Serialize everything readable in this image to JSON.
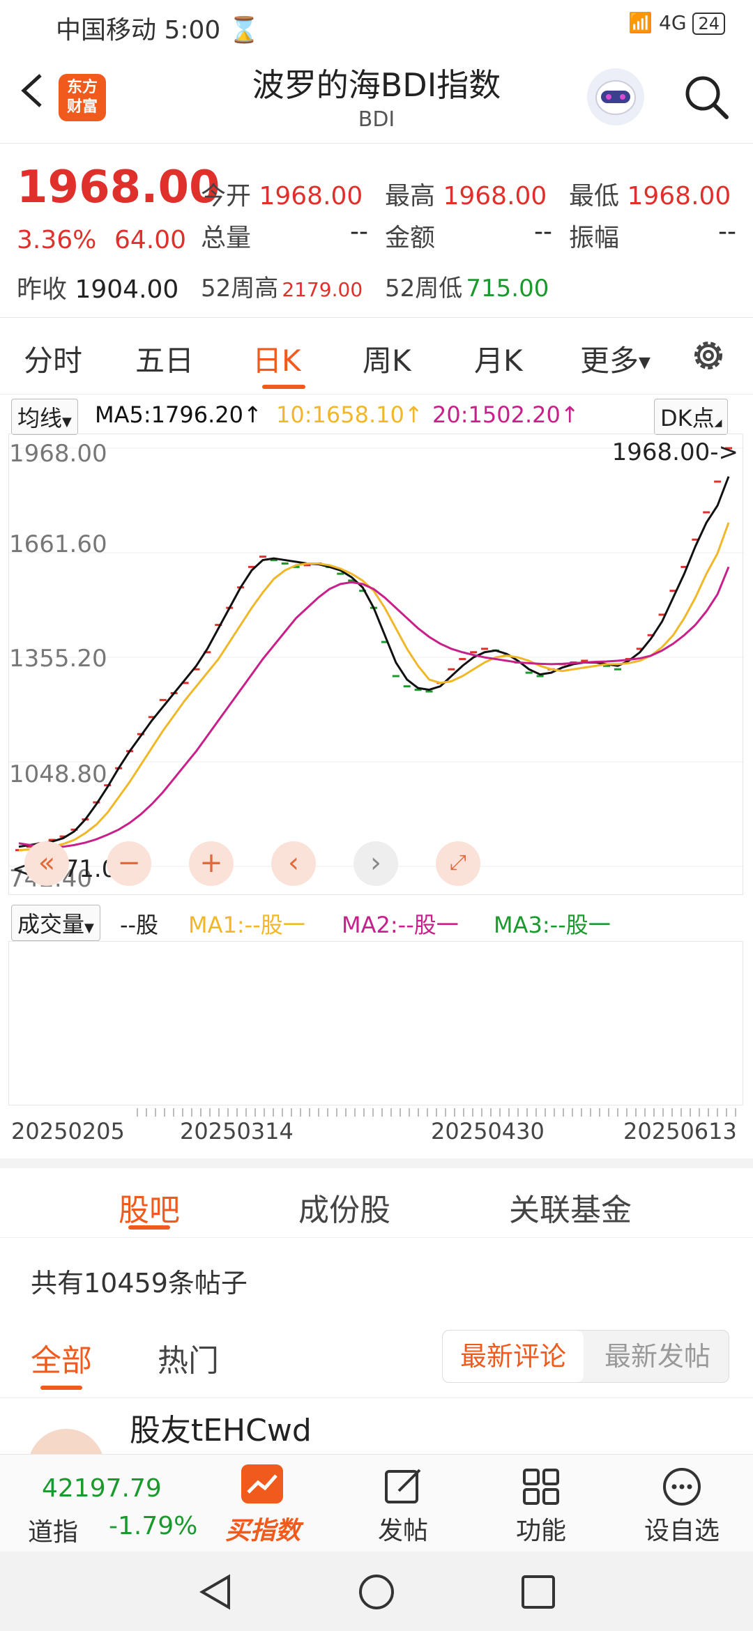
{
  "status": {
    "carrier": "中国移动",
    "time": "5:00",
    "network": "4G",
    "battery": "24"
  },
  "header": {
    "logo_line1": "东方",
    "logo_line2": "财富",
    "title": "波罗的海BDI指数",
    "code": "BDI"
  },
  "quote": {
    "price": "1968.00",
    "change_pct": "3.36%",
    "change_amt": "64.00",
    "prev_close_label": "昨收",
    "prev_close": "1904.00",
    "open_label": "今开",
    "open": "1968.00",
    "high_label": "最高",
    "high": "1968.00",
    "low_label": "最低",
    "low": "1968.00",
    "volume_label": "总量",
    "volume": "--",
    "amount_label": "金额",
    "amount": "--",
    "amplitude_label": "振幅",
    "amplitude": "--",
    "week52_high_label": "52周高",
    "week52_high": "2179.00",
    "week52_low_label": "52周低",
    "week52_low": "715.00"
  },
  "ktabs": [
    "分时",
    "五日",
    "日K",
    "周K",
    "月K",
    "更多"
  ],
  "ma": {
    "selector": "均线",
    "ma5": "MA5:1796.20↑",
    "ma10": "10:1658.10↑",
    "ma20": "20:1502.20↑",
    "dk": "DK点"
  },
  "colors": {
    "accent": "#f05a1d",
    "red": "#e0302c",
    "green": "#1a9a2c",
    "ma5": "#111111",
    "ma10": "#f0b829",
    "ma20": "#c8208a"
  },
  "chart_data": {
    "type": "line",
    "y_ticks": [
      "1968.00",
      "1661.60",
      "1355.20",
      "1048.80",
      "742.40"
    ],
    "last_price_label": "1968.00->",
    "low_label": "<--771.00",
    "ylim": [
      742.4,
      1968.0
    ],
    "x_ticks": [
      "20250205",
      "20250314",
      "20250430",
      "20250613"
    ],
    "candles": [
      790,
      800,
      810,
      820,
      830,
      850,
      880,
      930,
      980,
      1030,
      1080,
      1130,
      1180,
      1230,
      1250,
      1280,
      1320,
      1370,
      1450,
      1500,
      1560,
      1620,
      1650,
      1640,
      1630,
      1620,
      1625,
      1630,
      1620,
      1600,
      1580,
      1550,
      1500,
      1400,
      1300,
      1270,
      1260,
      1255,
      1280,
      1320,
      1350,
      1370,
      1380,
      1375,
      1360,
      1340,
      1310,
      1300,
      1320,
      1335,
      1340,
      1345,
      1340,
      1330,
      1320,
      1350,
      1380,
      1420,
      1480,
      1550,
      1620,
      1700,
      1780,
      1870,
      1968
    ],
    "series": [
      {
        "name": "MA5",
        "values": [
          800,
          805,
          810,
          815,
          825,
          845,
          880,
          925,
          975,
          1030,
          1080,
          1125,
          1170,
          1210,
          1250,
          1290,
          1330,
          1380,
          1440,
          1500,
          1560,
          1610,
          1640,
          1645,
          1640,
          1635,
          1630,
          1628,
          1620,
          1610,
          1590,
          1560,
          1500,
          1420,
          1340,
          1290,
          1265,
          1260,
          1270,
          1300,
          1330,
          1355,
          1370,
          1375,
          1365,
          1345,
          1320,
          1305,
          1310,
          1325,
          1335,
          1340,
          1340,
          1335,
          1330,
          1345,
          1370,
          1410,
          1460,
          1530,
          1600,
          1680,
          1750,
          1800,
          1885
        ]
      },
      {
        "name": "MA10",
        "values": [
          790,
          792,
          795,
          800,
          808,
          820,
          840,
          865,
          900,
          945,
          990,
          1040,
          1090,
          1140,
          1185,
          1230,
          1270,
          1310,
          1350,
          1400,
          1450,
          1500,
          1545,
          1585,
          1610,
          1625,
          1630,
          1630,
          1625,
          1615,
          1600,
          1580,
          1550,
          1500,
          1440,
          1380,
          1330,
          1290,
          1280,
          1285,
          1300,
          1320,
          1340,
          1355,
          1360,
          1355,
          1345,
          1330,
          1320,
          1315,
          1320,
          1325,
          1330,
          1335,
          1335,
          1338,
          1345,
          1360,
          1385,
          1420,
          1470,
          1530,
          1600,
          1660,
          1750
        ]
      },
      {
        "name": "MA20",
        "values": [
          810,
          805,
          800,
          798,
          800,
          805,
          812,
          822,
          835,
          850,
          870,
          895,
          925,
          960,
          1000,
          1040,
          1080,
          1125,
          1170,
          1215,
          1260,
          1305,
          1350,
          1390,
          1430,
          1470,
          1500,
          1530,
          1555,
          1570,
          1575,
          1570,
          1555,
          1530,
          1500,
          1470,
          1440,
          1415,
          1395,
          1380,
          1370,
          1362,
          1355,
          1350,
          1345,
          1340,
          1338,
          1336,
          1335,
          1336,
          1338,
          1340,
          1342,
          1343,
          1345,
          1348,
          1352,
          1360,
          1375,
          1395,
          1420,
          1450,
          1490,
          1540,
          1620
        ]
      }
    ]
  },
  "volume": {
    "selector": "成交量",
    "unit": "--股",
    "ma1": "MA1:--股一",
    "ma2": "MA2:--股一",
    "ma3": "MA3:--股一"
  },
  "bottom_tabs": [
    "股吧",
    "成份股",
    "关联基金"
  ],
  "posts": {
    "count_text": "共有10459条帖子",
    "filter_all": "全部",
    "filter_hot": "热门",
    "sort_comment": "最新评论",
    "sort_post": "最新发帖",
    "first_author": "股友tEHCwd"
  },
  "bottom_nav": {
    "dow_value": "42197.79",
    "dow_label": "道指",
    "dow_change": "-1.79%",
    "buy_index": "买指数",
    "post": "发帖",
    "func": "功能",
    "watch": "设自选"
  }
}
